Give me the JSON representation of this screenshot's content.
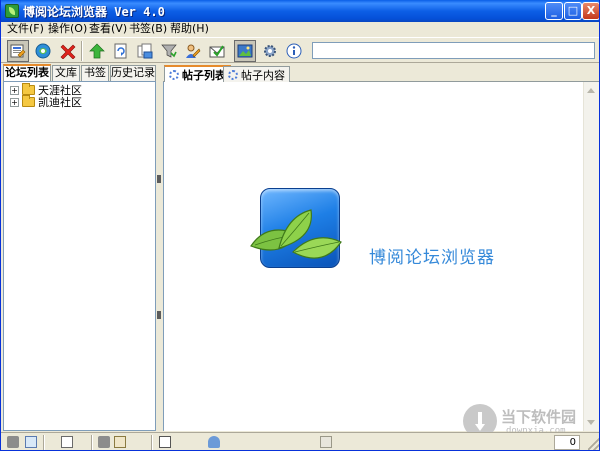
{
  "window": {
    "title": "博阅论坛浏览器 Ver 4.0",
    "minimize": "_",
    "maximize": "□",
    "close": "X"
  },
  "menu": [
    {
      "label": "文件(F)"
    },
    {
      "label": "操作(O)"
    },
    {
      "label": "查看(V)"
    },
    {
      "label": "书签(B)"
    },
    {
      "label": "帮助(H)"
    }
  ],
  "toolbar": {
    "icons": [
      "browse-icon",
      "connect-icon",
      "stop-icon",
      "up-icon",
      "refresh-icon",
      "save-icon",
      "filter-icon",
      "user-icon",
      "mail-icon",
      "view-icon",
      "settings-icon",
      "info-icon"
    ],
    "address_value": ""
  },
  "left_tabs": [
    {
      "label": "论坛列表",
      "active": true
    },
    {
      "label": "文库"
    },
    {
      "label": "书签"
    },
    {
      "label": "历史记录"
    }
  ],
  "tree": [
    {
      "label": "天涯社区"
    },
    {
      "label": "凯迪社区"
    }
  ],
  "right_tabs": [
    {
      "label": "帖子列表",
      "active": true
    },
    {
      "label": "帖子内容"
    }
  ],
  "content": {
    "brand": "博阅论坛浏览器"
  },
  "watermark": {
    "title": "当下软件园",
    "url": "downxia.com"
  },
  "status": {
    "counter": "0"
  },
  "colors": {
    "titlebar": "#0a5ee7",
    "accent_tab": "#e68b2c",
    "brand_text": "#3589d9",
    "logo_blue": "#1e7fe6",
    "leaf_green": "#7cc242"
  }
}
